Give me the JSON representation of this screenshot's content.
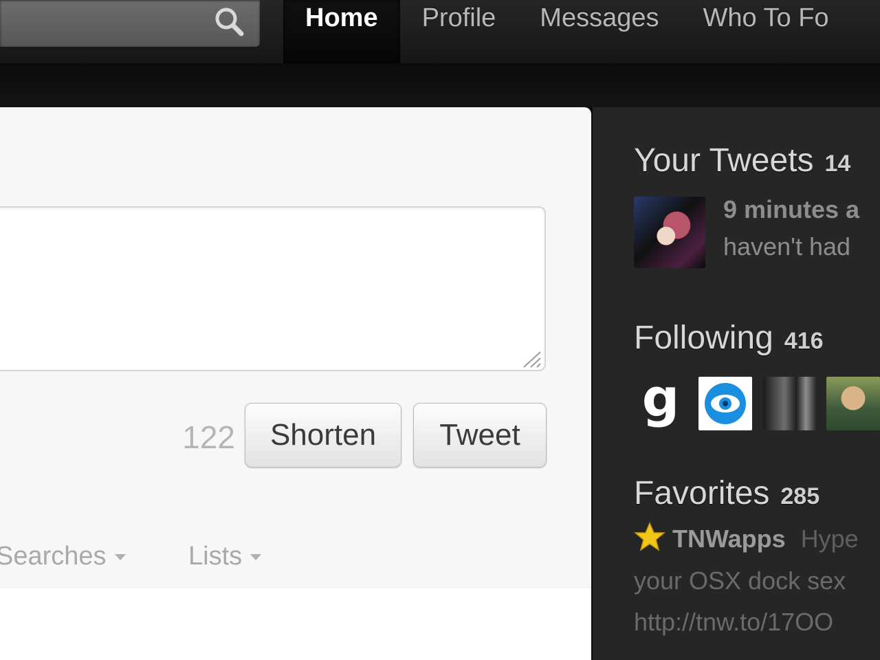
{
  "colors": {
    "topbar": "#1c1c1c",
    "panel": "#f7f7f7",
    "dashboard": "#262626",
    "avatar_blue": "#1a8fe0"
  },
  "search": {
    "placeholder": "",
    "icon": "search-icon"
  },
  "nav": {
    "items": [
      {
        "label": "Home",
        "active": true
      },
      {
        "label": "Profile",
        "active": false
      },
      {
        "label": "Messages",
        "active": false
      },
      {
        "label": "Who To Fo",
        "active": false
      }
    ]
  },
  "composer": {
    "value": "",
    "char_count": "122",
    "shorten_label": "Shorten",
    "tweet_label": "Tweet"
  },
  "tabs": {
    "searches": "Searches",
    "lists": "Lists"
  },
  "dashboard": {
    "tweets": {
      "heading": "Your Tweets",
      "count": "14",
      "time": "9 minutes a",
      "text": "haven't had"
    },
    "following": {
      "heading": "Following",
      "count": "416",
      "avatars": [
        "g-logo-avatar",
        "eye-app-avatar",
        "photo-avatar",
        "person-avatar"
      ]
    },
    "favorites": {
      "heading": "Favorites",
      "count": "285",
      "user": "TNWapps",
      "text_start": "Hype",
      "line2": "your OSX dock sex",
      "line3": "http://tnw.to/17OO"
    }
  }
}
